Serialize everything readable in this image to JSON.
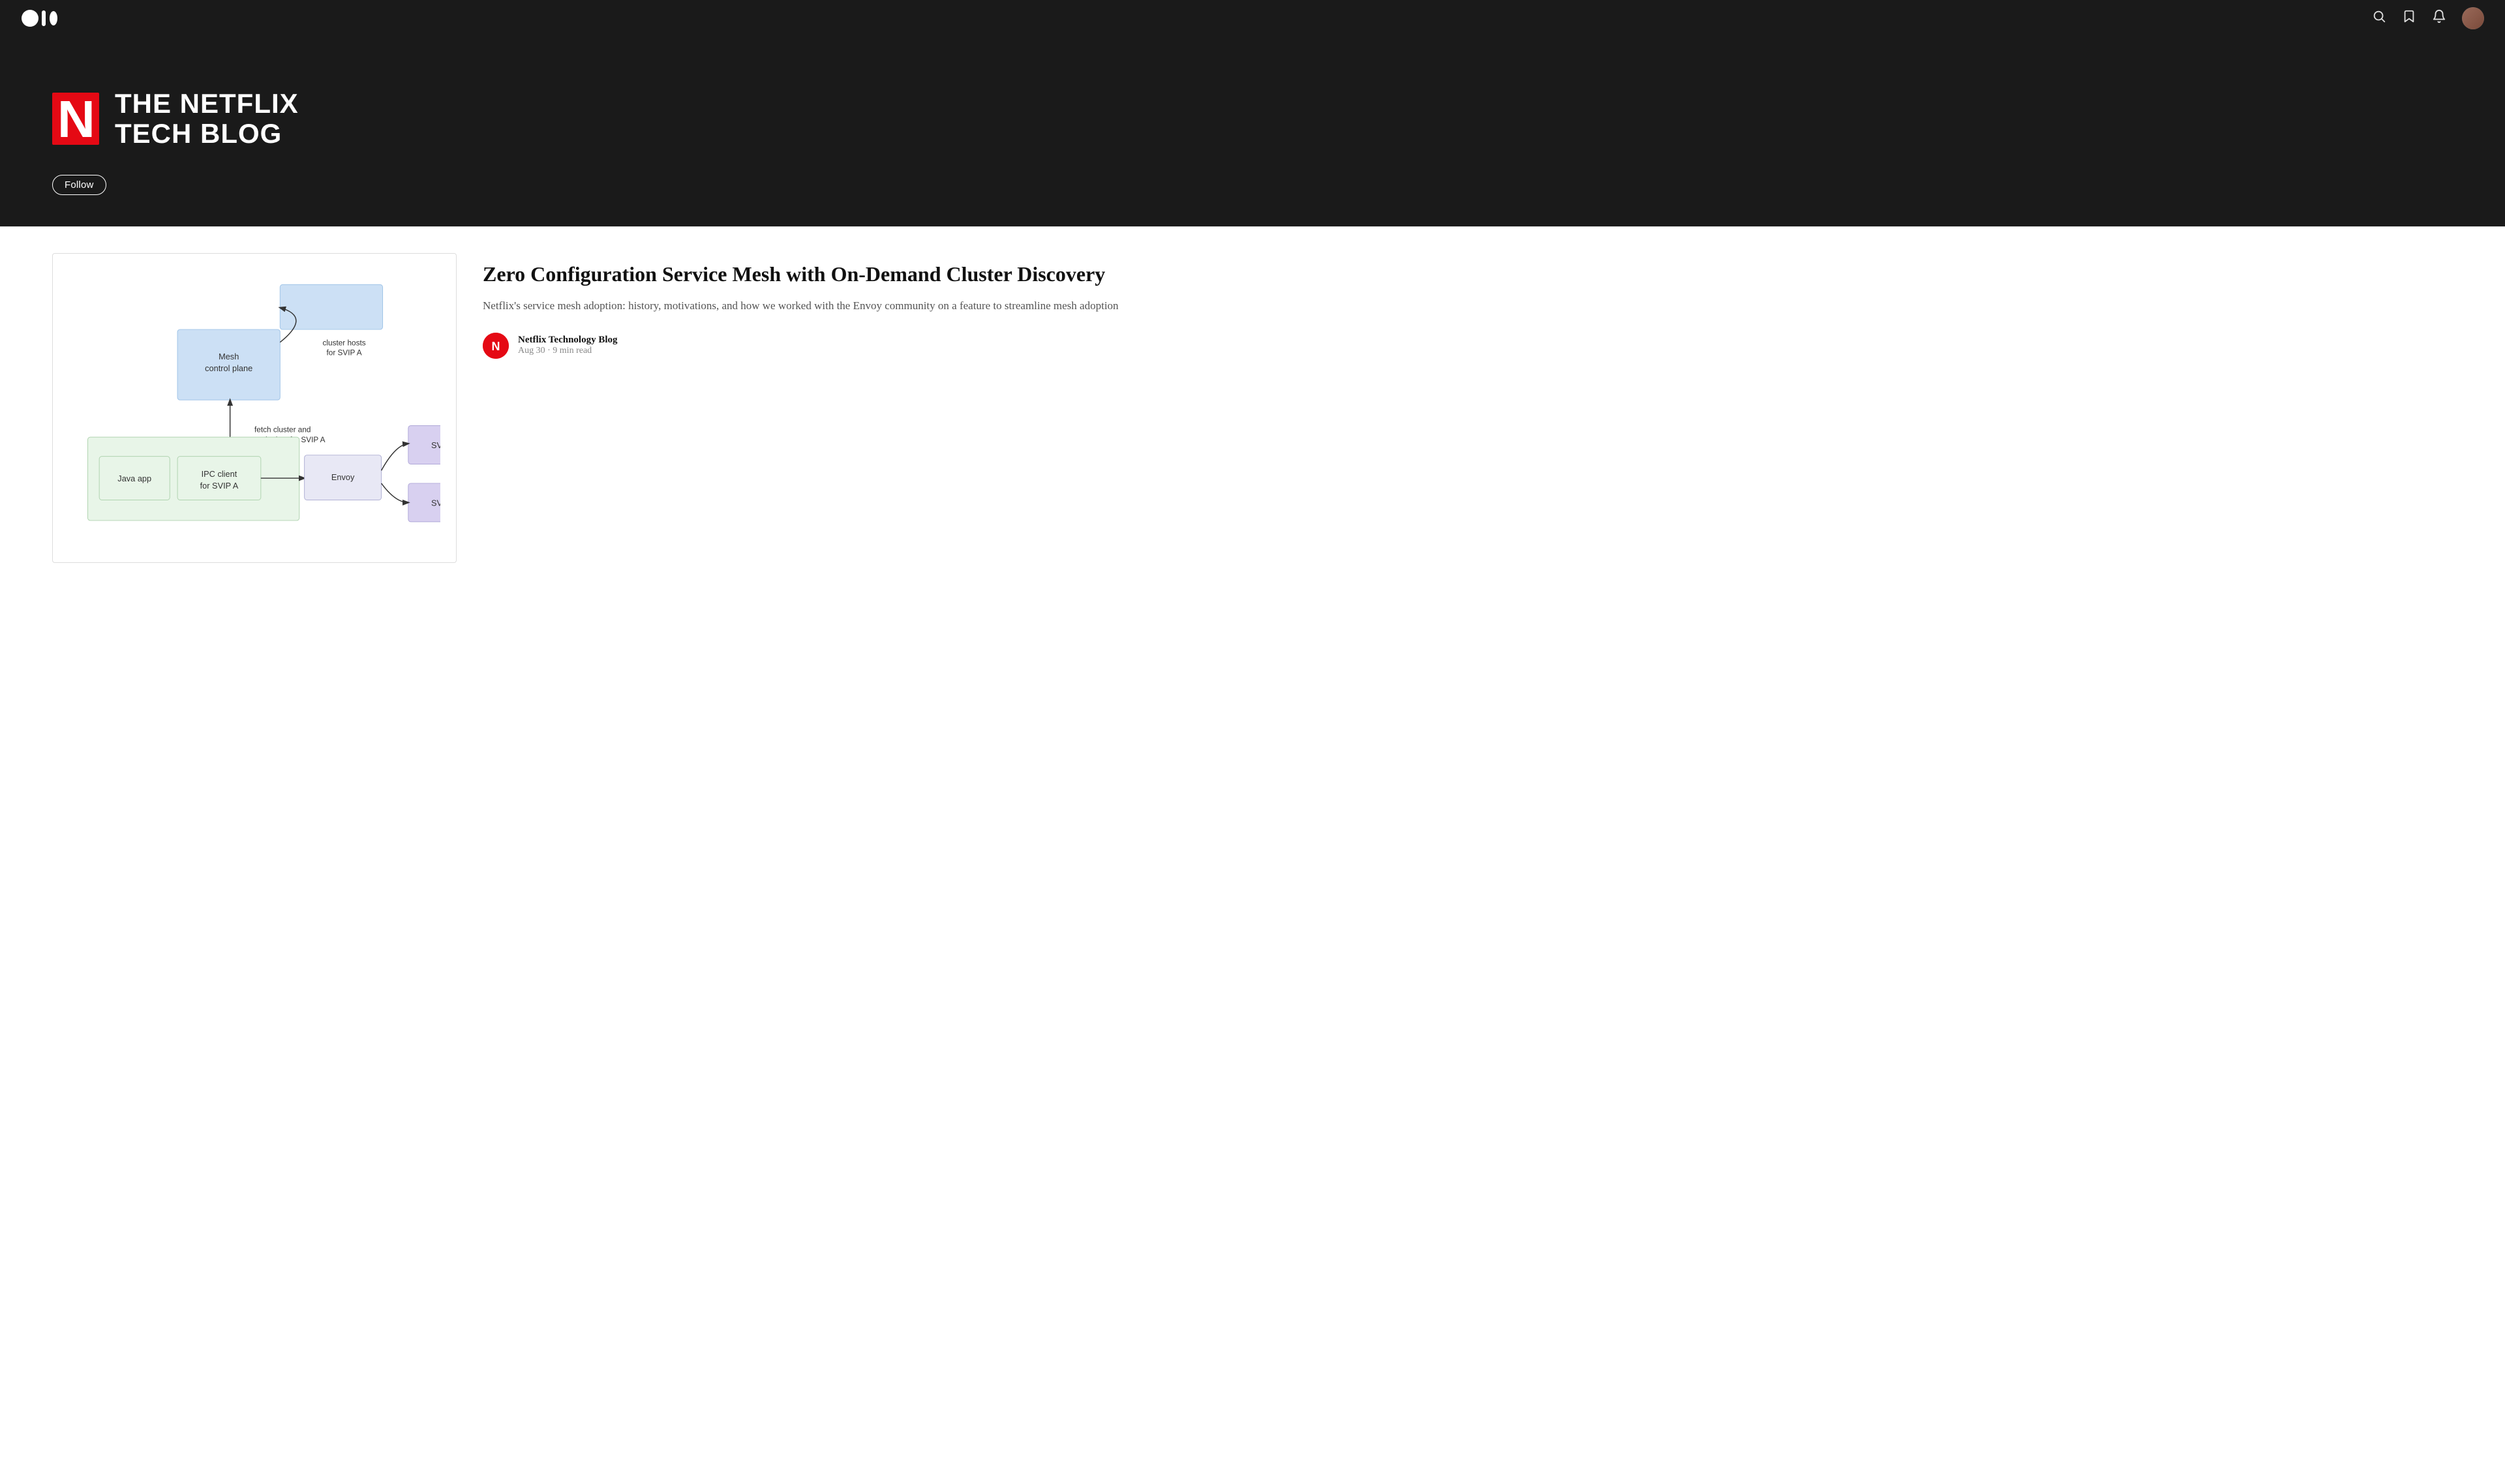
{
  "nav": {
    "logo_alt": "Medium",
    "icons": [
      "search",
      "bookmark",
      "bell",
      "avatar"
    ]
  },
  "hero": {
    "blog_title_line1": "THE NETFLIX",
    "blog_title_line2": "TECH BLOG",
    "follow_label": "Follow"
  },
  "article": {
    "title": "Zero Configuration Service Mesh with On-Demand Cluster Discovery",
    "subtitle": "Netflix's service mesh adoption: history, motivations, and how we worked with the Envoy community on a feature to streamline mesh adoption",
    "author_name": "Netflix Technology Blog",
    "date": "Aug 30",
    "read_time": "9 min read"
  },
  "diagram": {
    "mesh_control_plane_label": "Mesh control plane",
    "fetch_label": "fetch cluster and",
    "fetch_label2": "endpoints for SVIP A",
    "cluster_hosts_label": "cluster hosts",
    "cluster_hosts_label2": "for SVIP A",
    "java_app_label": "Java app",
    "ipc_client_label": "IPC client",
    "ipc_client_label2": "for SVIP A",
    "envoy_label": "Envoy",
    "svip_host1_label": "SVIP A host",
    "svip_host2_label": "SVIP A host"
  }
}
